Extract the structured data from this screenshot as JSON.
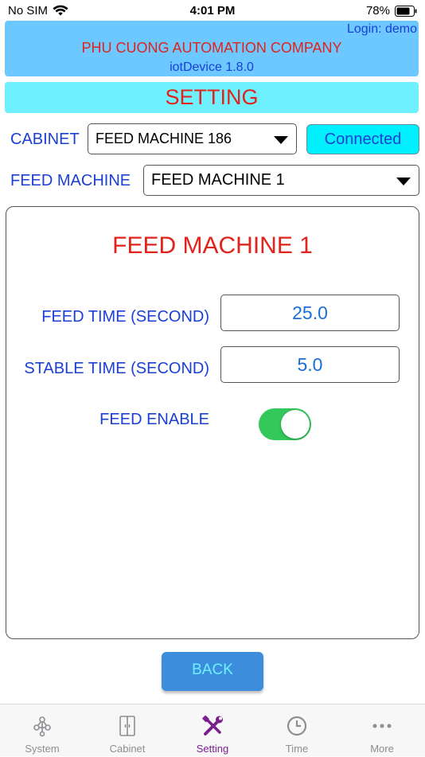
{
  "status_bar": {
    "carrier": "No SIM",
    "time": "4:01 PM",
    "battery": "78%"
  },
  "header": {
    "login": "Login: demo",
    "company": "PHU CUONG AUTOMATION COMPANY",
    "version": "iotDevice 1.8.0"
  },
  "page_title": "SETTING",
  "cabinet": {
    "label": "CABINET",
    "selected": "FEED MACHINE 186",
    "connection_status": "Connected"
  },
  "feed_machine_select": {
    "label": "FEED MACHINE",
    "selected": "FEED MACHINE 1"
  },
  "panel": {
    "title": "FEED MACHINE 1",
    "feed_time_label": "FEED TIME (SECOND)",
    "feed_time_value": "25.0",
    "stable_time_label": "STABLE TIME (SECOND)",
    "stable_time_value": "5.0",
    "feed_enable_label": "FEED ENABLE",
    "feed_enable_on": true
  },
  "back_label": "BACK",
  "tabs": [
    {
      "label": "System",
      "icon": "network-icon",
      "active": false
    },
    {
      "label": "Cabinet",
      "icon": "cabinet-icon",
      "active": false
    },
    {
      "label": "Setting",
      "icon": "tools-icon",
      "active": true
    },
    {
      "label": "Time",
      "icon": "clock-icon",
      "active": false
    },
    {
      "label": "More",
      "icon": "more-dots-icon",
      "active": false
    }
  ],
  "colors": {
    "header_bg": "#6cc8ff",
    "title_red": "#e0231c",
    "label_blue": "#1a3fd6",
    "toggle_on": "#34c759",
    "tab_active": "#7a1f8c"
  }
}
